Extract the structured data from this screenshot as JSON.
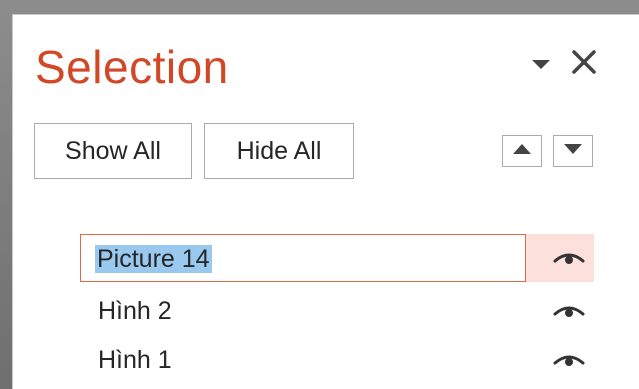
{
  "pane": {
    "title": "Selection",
    "buttons": {
      "show_all": "Show All",
      "hide_all": "Hide All"
    },
    "order_icons": {
      "up": "triangle-up-icon",
      "down": "triangle-down-icon"
    },
    "items": [
      {
        "label": "Picture 14",
        "selected": true,
        "visible": true
      },
      {
        "label": "Hình 2",
        "selected": false,
        "visible": true
      },
      {
        "label": "Hình 1",
        "selected": false,
        "visible": true
      }
    ]
  },
  "colors": {
    "title": "#d24726",
    "selection_border": "#e0694c",
    "selection_row_bg": "#fbe0db",
    "text_highlight": "#99c9ef"
  },
  "icons": {
    "menu": "dropdown-arrow-icon",
    "close": "close-icon",
    "visibility": "eye-icon"
  }
}
